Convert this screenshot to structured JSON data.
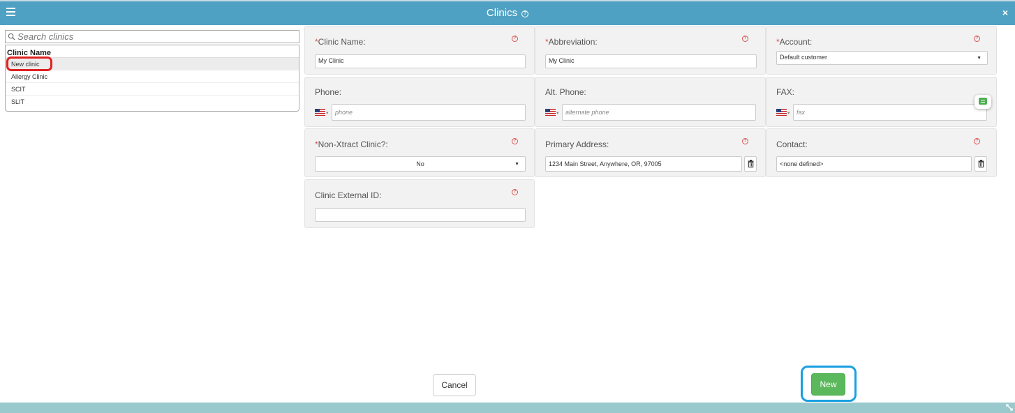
{
  "header": {
    "title": "Clinics",
    "help_glyph": "?",
    "close_glyph": "×"
  },
  "search": {
    "placeholder": "Search clinics"
  },
  "list": {
    "header": "Clinic Name",
    "items": [
      "New clinic",
      "Allergy Clinic",
      "SCIT",
      "SLIT"
    ],
    "selected_index": 0
  },
  "form": {
    "clinic_name": {
      "label": "Clinic Name:",
      "required_mark": "*",
      "value": "My Clinic"
    },
    "abbreviation": {
      "label": "Abbreviation:",
      "required_mark": "*",
      "value": "My Clinic"
    },
    "account": {
      "label": "Account:",
      "required_mark": "*",
      "value": "Default customer"
    },
    "phone": {
      "label": "Phone:",
      "placeholder": "phone"
    },
    "alt_phone": {
      "label": "Alt. Phone:",
      "placeholder": "alternate phone"
    },
    "fax": {
      "label": "FAX:",
      "placeholder": "fax"
    },
    "non_xtract": {
      "label": "Non-Xtract Clinic?:",
      "required_mark": "*",
      "value": "No"
    },
    "primary_address": {
      "label": "Primary Address:",
      "value": "1234 Main Street, Anywhere, OR, 97005"
    },
    "contact": {
      "label": "Contact:",
      "value": "<none defined>"
    },
    "external_id": {
      "label": "Clinic External ID:",
      "value": ""
    }
  },
  "buttons": {
    "cancel": "Cancel",
    "new": "New"
  },
  "colors": {
    "header": "#4fa1c3",
    "footer": "#99c9cc",
    "new_button": "#5cb85c",
    "required": "#d9534f",
    "highlight_red": "#e02020",
    "highlight_blue": "#1a9fe0"
  },
  "icons": [
    "hamburger-icon",
    "help-icon",
    "close-icon",
    "search-icon",
    "us-flag-icon",
    "trash-icon",
    "chat-icon",
    "resize-icon"
  ]
}
